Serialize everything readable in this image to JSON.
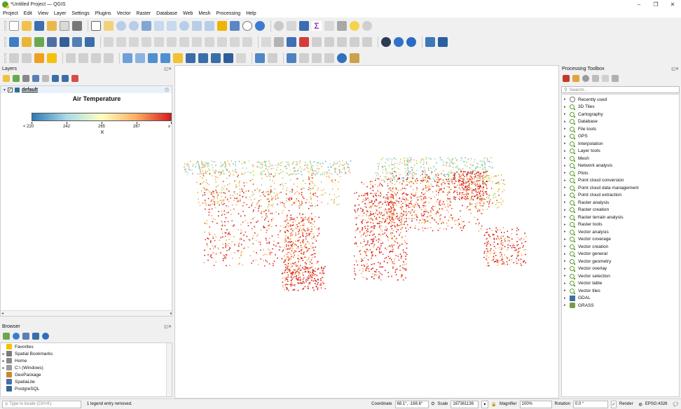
{
  "window": {
    "title": "*Untitled Project — QGIS",
    "minimize": "–",
    "restore": "❐",
    "close": "✕"
  },
  "menu": [
    "Project",
    "Edit",
    "View",
    "Layer",
    "Settings",
    "Plugins",
    "Vector",
    "Raster",
    "Database",
    "Web",
    "Mesh",
    "Processing",
    "Help"
  ],
  "layers_panel": {
    "title": "Layers",
    "layer_name": "default",
    "legend": {
      "title": "Air Temperature",
      "ticks": [
        "< 220",
        "242",
        "265",
        "287",
        "≥"
      ],
      "unit": "K",
      "colors": [
        "#2c7bb6",
        "#abd9e9",
        "#ffffbf",
        "#fdae61",
        "#d7191c"
      ]
    }
  },
  "browser_panel": {
    "title": "Browser",
    "items": [
      {
        "label": "Favorites",
        "icon": "star-icon",
        "color": "#f2c200",
        "arrow": ""
      },
      {
        "label": "Spatial Bookmarks",
        "icon": "bookmark-icon",
        "color": "#7a7a7a",
        "arrow": "▸"
      },
      {
        "label": "Home",
        "icon": "home-icon",
        "color": "#8a8a8a",
        "arrow": "▸"
      },
      {
        "label": "C:\\ (Windows)",
        "icon": "drive-icon",
        "color": "#9a9a9a",
        "arrow": "▸"
      },
      {
        "label": "GeoPackage",
        "icon": "geopackage-icon",
        "color": "#c98a2b",
        "arrow": ""
      },
      {
        "label": "SpatiaLite",
        "icon": "spatialite-icon",
        "color": "#4a6da8",
        "arrow": ""
      },
      {
        "label": "PostgreSQL",
        "icon": "postgresql-icon",
        "color": "#336791",
        "arrow": ""
      }
    ]
  },
  "processing_panel": {
    "title": "Processing Toolbox",
    "search_placeholder": "Search...",
    "items": [
      "Recently used",
      "3D Tiles",
      "Cartography",
      "Database",
      "File tools",
      "GPS",
      "Interpolation",
      "Layer tools",
      "Mesh",
      "Network analysis",
      "Plots",
      "Point cloud conversion",
      "Point cloud data management",
      "Point cloud extraction",
      "Raster analysis",
      "Raster creation",
      "Raster terrain analysis",
      "Raster tools",
      "Vector analysis",
      "Vector coverage",
      "Vector creation",
      "Vector general",
      "Vector geometry",
      "Vector overlay",
      "Vector selection",
      "Vector table",
      "Vector tiles",
      "GDAL",
      "GRASS"
    ]
  },
  "statusbar": {
    "locator_placeholder": "Type to locate (Ctrl+K)",
    "message": "1 legend entry removed.",
    "coordinate_label": "Coordinate",
    "coordinate_value": "68.1°, -168.6°",
    "scale_label": "Scale",
    "scale_value": "167361136",
    "magnifier_label": "Magnifier",
    "magnifier_value": "100%",
    "rotation_label": "Rotation",
    "rotation_value": "0.0 °",
    "render_label": "Render",
    "crs": "EPSG:4326"
  },
  "map_colors": [
    "#d7191c",
    "#e3442b",
    "#f4a261",
    "#fdae61",
    "#ffffbf",
    "#a6d96a",
    "#abd9e9",
    "#6bb4d6"
  ]
}
